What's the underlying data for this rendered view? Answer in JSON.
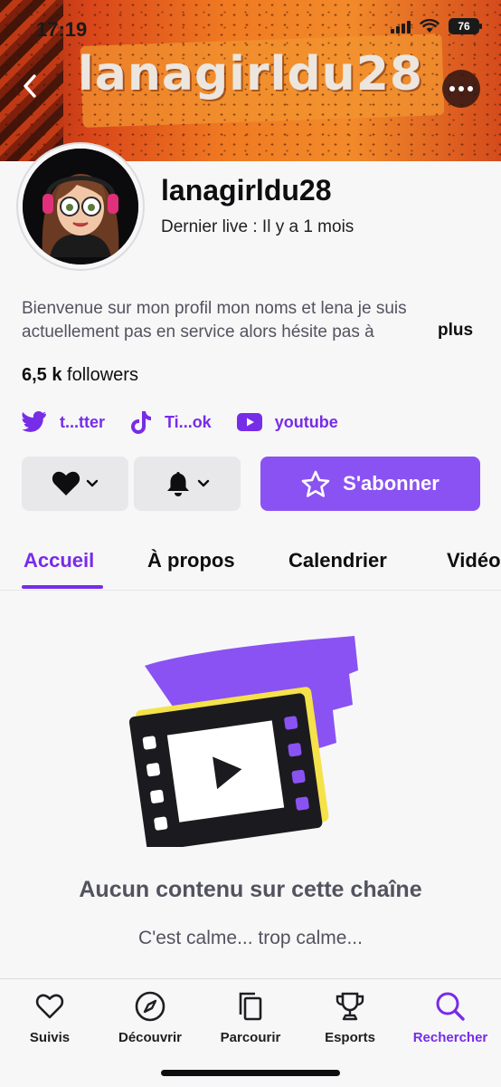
{
  "status_bar": {
    "time": "17:19",
    "battery": "76"
  },
  "banner": {
    "title": "lanagirldu28"
  },
  "profile": {
    "channel_name": "lanagirldu28",
    "last_live": "Dernier live : Il y a 1 mois",
    "bio": "Bienvenue sur mon profil mon noms et lena je suis actuellement pas en service alors hésite pas à",
    "bio_more": "plus",
    "followers_count": "6,5 k",
    "followers_label": "followers"
  },
  "socials": [
    {
      "label": "t...tter",
      "icon": "twitter-icon"
    },
    {
      "label": "Ti...ok",
      "icon": "tiktok-icon"
    },
    {
      "label": "youtube",
      "icon": "youtube-icon"
    }
  ],
  "actions": {
    "subscribe_label": "S'abonner"
  },
  "tabs": [
    {
      "label": "Accueil",
      "active": true
    },
    {
      "label": "À propos",
      "active": false
    },
    {
      "label": "Calendrier",
      "active": false
    },
    {
      "label": "Vidéos",
      "active": false
    }
  ],
  "empty_state": {
    "title": "Aucun contenu sur cette chaîne",
    "subtitle": "C'est calme... trop calme..."
  },
  "bottom_nav": [
    {
      "label": "Suivis",
      "icon": "heart-icon",
      "active": false
    },
    {
      "label": "Découvrir",
      "icon": "compass-icon",
      "active": false
    },
    {
      "label": "Parcourir",
      "icon": "browse-icon",
      "active": false
    },
    {
      "label": "Esports",
      "icon": "trophy-icon",
      "active": false
    },
    {
      "label": "Rechercher",
      "icon": "search-icon",
      "active": true
    }
  ],
  "colors": {
    "accent": "#772ce8",
    "subscribe": "#8a52f2",
    "banner": "#f07a22"
  }
}
